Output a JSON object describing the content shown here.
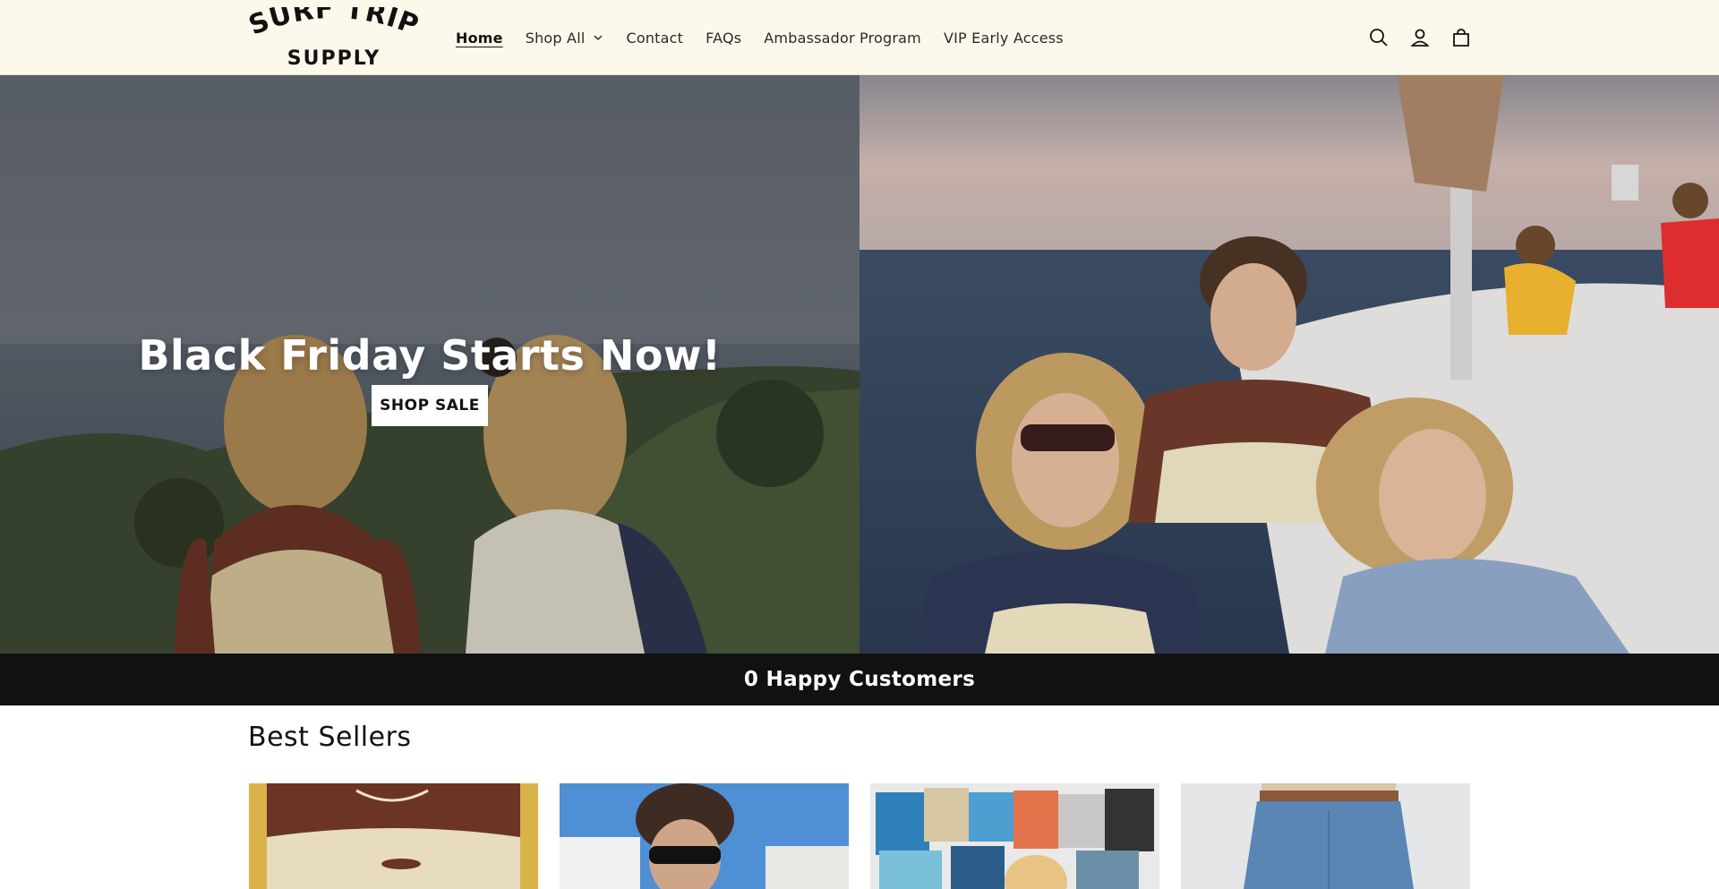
{
  "header": {
    "logo_alt": "Surf Trip Supply",
    "logo_line1": "SURF TRIP",
    "logo_line2": "SUPPLY",
    "nav": [
      {
        "label": "Home",
        "active": true
      },
      {
        "label": "Shop All",
        "has_dropdown": true
      },
      {
        "label": "Contact"
      },
      {
        "label": "FAQs"
      },
      {
        "label": "Ambassador Program"
      },
      {
        "label": "VIP Early Access"
      }
    ],
    "icons": [
      "search-icon",
      "account-icon",
      "cart-icon"
    ]
  },
  "hero": {
    "title": "Black Friday Starts Now!",
    "button_label": "SHOP SALE"
  },
  "banner": {
    "text": "0 Happy Customers"
  },
  "best_sellers": {
    "title": "Best Sellers",
    "products": [
      {
        "image": "brown-cream-sweater"
      },
      {
        "image": "guy-sunglasses-sky"
      },
      {
        "image": "magazine-collage"
      },
      {
        "image": "jeans-belt"
      }
    ]
  },
  "colors": {
    "header_bg": "#fdf8ec",
    "banner_bg": "#111111",
    "button_bg": "#ffffff"
  }
}
